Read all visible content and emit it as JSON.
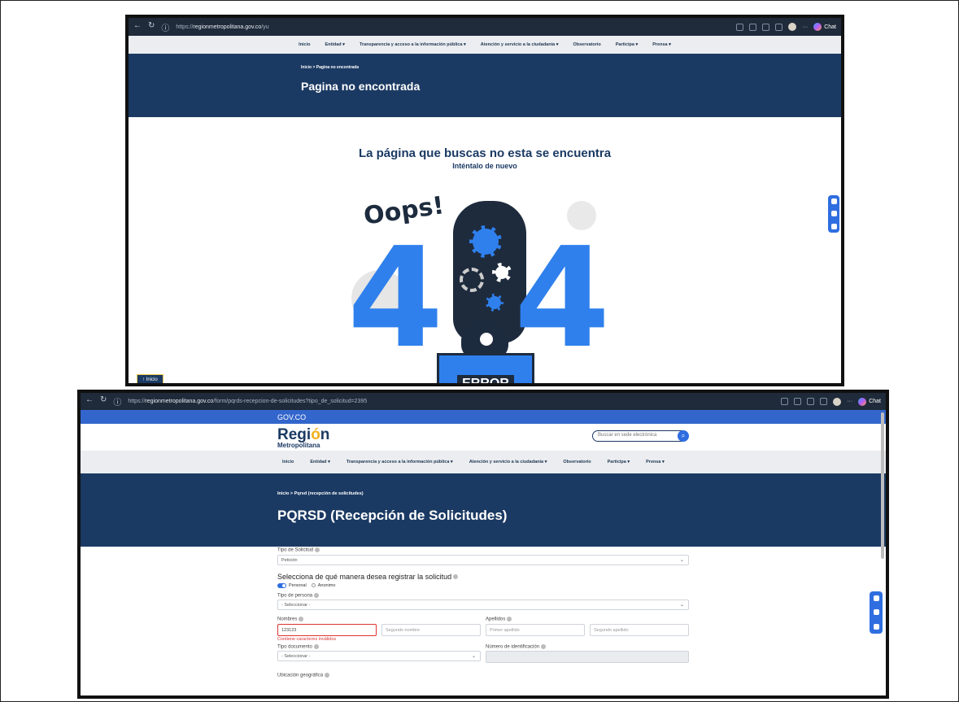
{
  "screen1": {
    "browser": {
      "url_prefix": "https://",
      "url_host": "regionmetropolitana.gov.co",
      "url_path": "/yu",
      "chat_label": "Chat"
    },
    "menu": [
      "Inicio",
      "Entidad ▾",
      "Transparencia y acceso a la información pública ▾",
      "Atención y servicio a la ciudadanía ▾",
      "Observatorio",
      "Participa ▾",
      "Prensa ▾"
    ],
    "breadcrumb": "Inicio  >  Pagina no encontrada",
    "page_title": "Pagina no encontrada",
    "heading": "La página que buscas no esta se encuentra",
    "subheading": "Inténtalo de nuevo",
    "illustration": {
      "oops": "Oops!",
      "digit_left": "4",
      "digit_right": "4",
      "error_label": "ERROR"
    },
    "back_button": "↑ Inicio"
  },
  "screen2": {
    "browser": {
      "url_prefix": "https://",
      "url_host": "regionmetropolitana.gov.co",
      "url_path": "/form/pqrds-recepcion-de-solicitudes?tipo_de_solicitud=2395",
      "chat_label": "Chat"
    },
    "gov_label": "GOV.CO",
    "brand": {
      "region_pre": "Regi",
      "region_accent": "ó",
      "region_post": "n",
      "metro": "Metropolitana"
    },
    "search": {
      "placeholder": "Buscar en sede electrónica"
    },
    "menu": [
      "Inicio",
      "Entidad ▾",
      "Transparencia y acceso a la información pública ▾",
      "Atención y servicio a la ciudadanía ▾",
      "Observatorio",
      "Participa ▾",
      "Prensa ▾"
    ],
    "breadcrumb": "Inicio  >  Pqrsd (recepción de solicitudes)",
    "page_title": "PQRSD (Recepción de Solicitudes)",
    "form": {
      "tipo_solicitud_label": "Tipo de Solicitud",
      "tipo_solicitud_value": "Petición",
      "registro_title": "Selecciona de qué manera desea registrar la solicitud",
      "personal_label": "Personal",
      "anonimo_label": "Anonimo",
      "tipo_persona_label": "Tipo de persona",
      "tipo_persona_value": "- Seleccionar -",
      "nombres_label": "Nombres",
      "nombres_value": "123123",
      "segundo_nombre_placeholder": "Segundo nombre",
      "apellidos_label": "Apellidos",
      "primer_apellido_placeholder": "Primer apellido",
      "segundo_apellido_placeholder": "Segundo apellido",
      "error_text": "Contiene caracteres inválidos",
      "tipo_documento_label": "Tipo documento",
      "tipo_documento_value": "- Seleccionar -",
      "numero_id_label": "Número de identificación",
      "ubicacion_label": "Ubicación geográfica"
    }
  }
}
